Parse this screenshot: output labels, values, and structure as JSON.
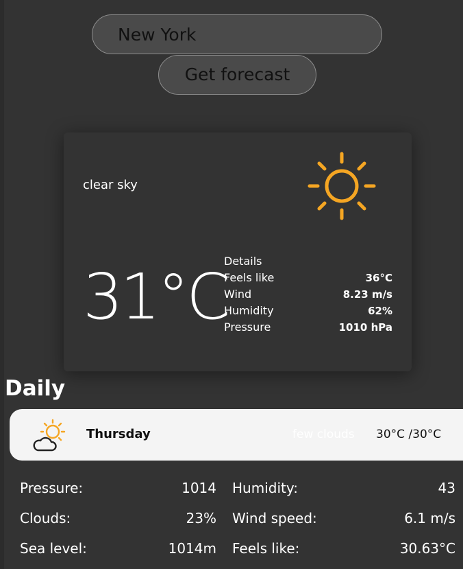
{
  "search": {
    "value": "New York",
    "button_label": "Get forecast"
  },
  "current": {
    "description": "clear sky",
    "icon": "sun-icon",
    "temperature": "31°C",
    "details_title": "Details",
    "details": [
      {
        "label": "Feels like",
        "value": "36°C"
      },
      {
        "label": "Wind",
        "value": "8.23 m/s"
      },
      {
        "label": "Humidity",
        "value": "62%"
      },
      {
        "label": "Pressure",
        "value": "1010 hPa"
      }
    ]
  },
  "daily": {
    "title": "Daily",
    "items": [
      {
        "day": "Thursday",
        "icon": "sun-behind-cloud-icon",
        "condition": "few clouds",
        "min_max": "30°C /30°C",
        "stats_left": [
          {
            "label": "Pressure:",
            "value": "1014"
          },
          {
            "label": "Clouds:",
            "value": "23%"
          },
          {
            "label": "Sea level:",
            "value": "1014m"
          }
        ],
        "stats_right": [
          {
            "label": "Humidity:",
            "value": "43"
          },
          {
            "label": "Wind speed:",
            "value": "6.1 m/s"
          },
          {
            "label": "Feels like:",
            "value": "30.63°C"
          }
        ]
      }
    ]
  },
  "colors": {
    "background": "#333333",
    "accent_sun": "#f5a623",
    "daily_row_bg": "#f4f4f4"
  }
}
